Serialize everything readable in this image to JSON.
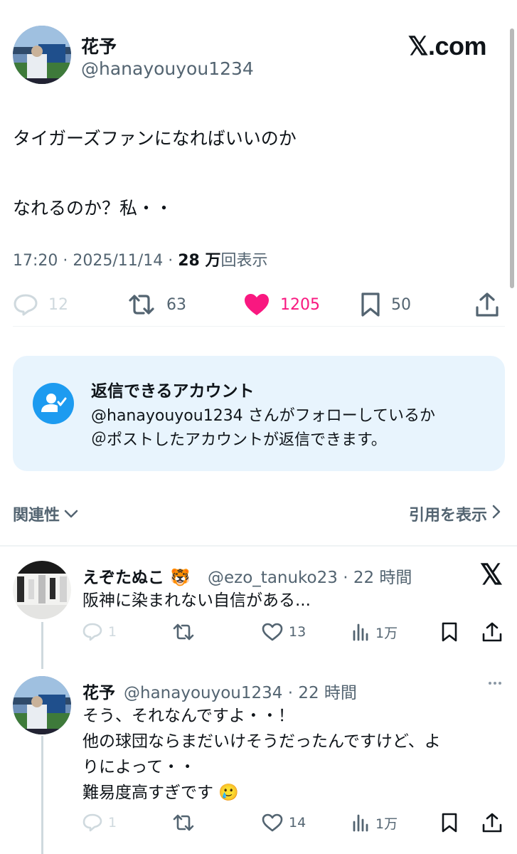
{
  "site": {
    "logo_text": "𝕏.com"
  },
  "post": {
    "display_name": "花予",
    "handle": "@hanayouyou1234",
    "lines": [
      "タイガーズファンになればいいのか",
      "なれるのか？私・・"
    ],
    "time": "17:20",
    "date": "2025/11/14",
    "views_count": "28 万",
    "views_suffix": "回表示",
    "replies": "12",
    "reposts": "63",
    "likes": "1205",
    "bookmarks": "50"
  },
  "reply_settings": {
    "title": "返信できるアカウント",
    "line1": "@hanayouyou1234 さんがフォローしているか",
    "line2": "＠ポストしたアカウントが返信できます。"
  },
  "nav": {
    "related_label": "関連性",
    "quotes_label": "引用を表示"
  },
  "replies": [
    {
      "display_name": "えぞたぬこ 🐯",
      "handle_time": "@ezo_tanuko23 · 22 時間",
      "lines": [
        "阪神に染まれない自信がある..."
      ],
      "reply_count": "1",
      "repost_count": "",
      "like_count": "13",
      "view_count": "1万"
    },
    {
      "display_name": "花予",
      "handle_time": "@hanayouyou1234 · 22 時間",
      "lines": [
        "そう、それなんですよ・・！",
        "他の球団ならまだいけそうだったんですけど、よ",
        "りによって・・",
        "難易度高すぎです 🥲"
      ],
      "reply_count": "1",
      "repost_count": "",
      "like_count": "14",
      "view_count": "1万"
    }
  ],
  "colors": {
    "like": "#f91880",
    "accent": "#1d9bf0",
    "secondary_text": "#536471",
    "reply_box_bg": "#e8f4fd"
  },
  "icons": [
    "reply-icon",
    "repost-icon",
    "heart-icon",
    "bookmark-icon",
    "share-icon",
    "views-icon",
    "x-logo-icon",
    "more-icon",
    "chevron-down-icon",
    "chevron-right-icon",
    "person-check-icon"
  ]
}
